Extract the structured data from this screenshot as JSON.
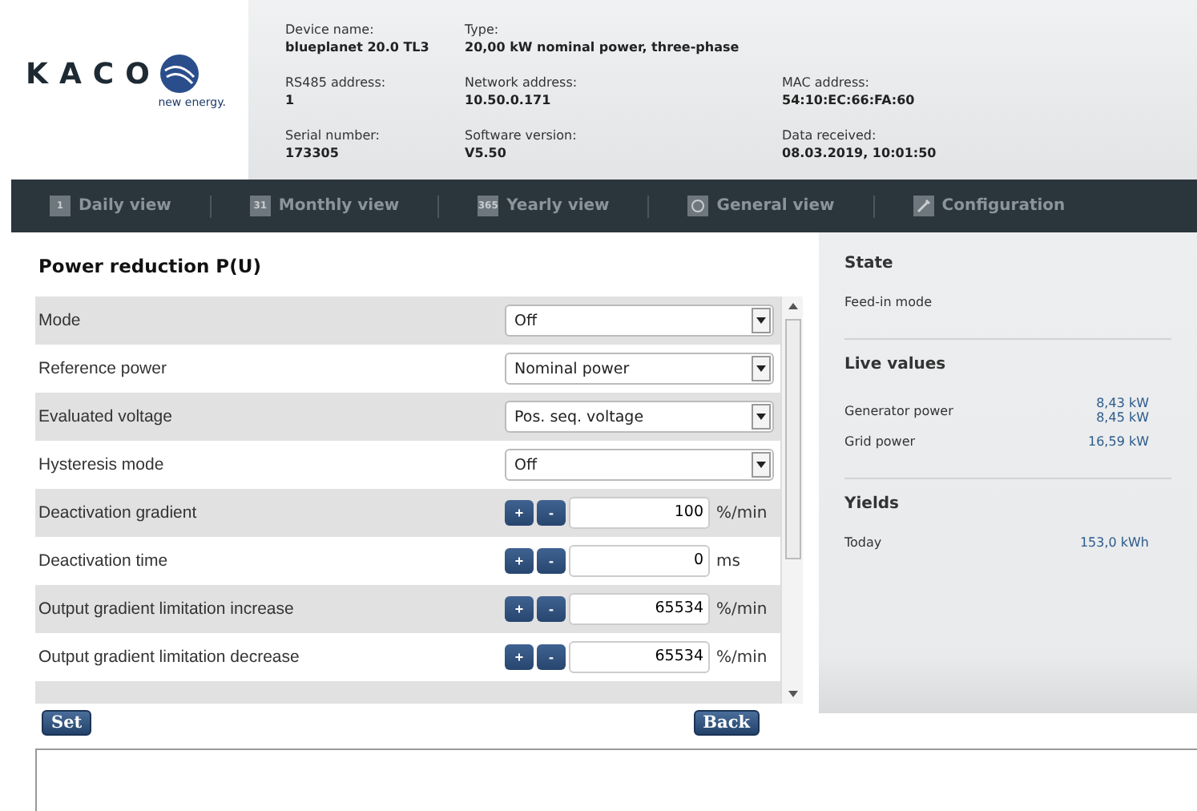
{
  "logo": {
    "wordmark": "KACO",
    "tagline": "new energy."
  },
  "device_info": [
    [
      {
        "label": "Device name:",
        "value": "blueplanet 20.0 TL3"
      },
      {
        "label": "Type:",
        "value": "20,00 kW nominal power, three-phase"
      }
    ],
    [
      {
        "label": "RS485 address:",
        "value": "1"
      },
      {
        "label": "Network address:",
        "value": "10.50.0.171"
      },
      {
        "label": "MAC address:",
        "value": "54:10:EC:66:FA:60"
      }
    ],
    [
      {
        "label": "Serial number:",
        "value": "173305"
      },
      {
        "label": "Software version:",
        "value": "V5.50"
      },
      {
        "label": "Data received:",
        "value": "08.03.2019, 10:01:50"
      }
    ]
  ],
  "nav": [
    {
      "label": "Daily view",
      "kind": "number",
      "icon_text": "1"
    },
    {
      "label": "Monthly view",
      "kind": "number",
      "icon_text": "31"
    },
    {
      "label": "Yearly view",
      "kind": "number",
      "icon_text": "365"
    },
    {
      "label": "General view",
      "kind": "globe"
    },
    {
      "label": "Configuration",
      "kind": "wrench"
    }
  ],
  "panel": {
    "title": "Power reduction P(U)",
    "rows": [
      {
        "label": "Mode",
        "kind": "select",
        "value": "Off"
      },
      {
        "label": "Reference power",
        "kind": "select",
        "value": "Nominal power"
      },
      {
        "label": "Evaluated voltage",
        "kind": "select",
        "value": "Pos. seq. voltage"
      },
      {
        "label": "Hysteresis mode",
        "kind": "select",
        "value": "Off"
      },
      {
        "label": "Deactivation gradient",
        "kind": "stepper",
        "value": "100",
        "unit": "%/min",
        "plus": "+",
        "minus": "-"
      },
      {
        "label": "Deactivation time",
        "kind": "stepper",
        "value": "0",
        "unit": "ms",
        "plus": "+",
        "minus": "-"
      },
      {
        "label": "Output gradient limitation increase",
        "kind": "stepper",
        "value": "65534",
        "unit": "%/min",
        "plus": "+",
        "minus": "-"
      },
      {
        "label": "Output gradient limitation decrease",
        "kind": "stepper",
        "value": "65534",
        "unit": "%/min",
        "plus": "+",
        "minus": "-"
      },
      {
        "kind": "partial"
      }
    ],
    "buttons": {
      "set": "Set",
      "back": "Back"
    }
  },
  "sidebar": {
    "sections": [
      {
        "title": "State",
        "items": [
          {
            "label": "Feed-in mode"
          }
        ]
      },
      {
        "title": "Live values",
        "items": [
          {
            "label": "Generator power",
            "values": [
              "8,43 kW",
              "8,45 kW"
            ]
          },
          {
            "label": "Grid power",
            "values": [
              "16,59 kW"
            ]
          }
        ]
      },
      {
        "title": "Yields",
        "items": [
          {
            "label": "Today",
            "values": [
              "153,0 kWh"
            ]
          }
        ]
      }
    ]
  }
}
